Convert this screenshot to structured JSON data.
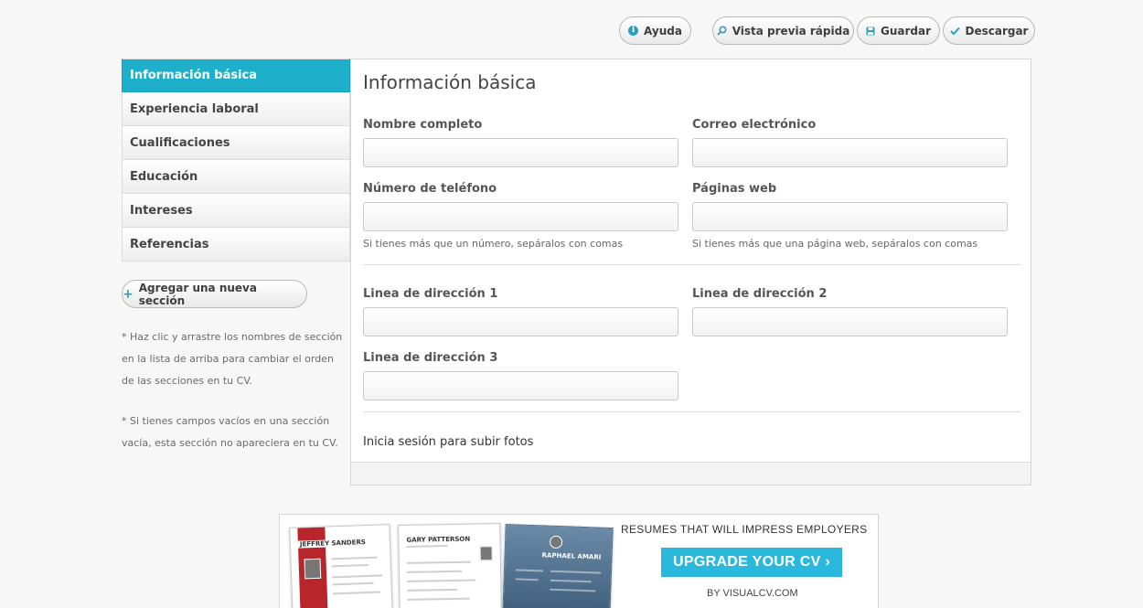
{
  "toolbar": {
    "help_label": "Ayuda",
    "help_icon": "info-icon",
    "preview_label": "Vista previa rápida",
    "preview_icon": "magnifier-icon",
    "save_label": "Guardar",
    "save_icon": "floppy-icon",
    "download_label": "Descargar",
    "download_icon": "check-icon"
  },
  "sidebar": {
    "items": [
      {
        "label": "Información básica",
        "active": true
      },
      {
        "label": "Experiencia laboral"
      },
      {
        "label": "Cualificaciones"
      },
      {
        "label": "Educación"
      },
      {
        "label": "Intereses"
      },
      {
        "label": "Referencias"
      }
    ],
    "add_section_label": "Agregar una nueva sección",
    "note1": "* Haz clic y arrastre los nombres de sección en la lista de arriba para cambiar el orden de las secciones en tu CV.",
    "note2": "* Si tienes campos vacíos en una sección vacía, esta sección no apareciera en tu CV."
  },
  "form": {
    "title": "Información básica",
    "full_name": {
      "label": "Nombre completo",
      "value": ""
    },
    "email": {
      "label": "Correo electrónico",
      "value": ""
    },
    "phone": {
      "label": "Número de teléfono",
      "value": "",
      "hint": "Si tienes más que un número, sepáralos con comas"
    },
    "websites": {
      "label": "Páginas web",
      "value": "",
      "hint": "Si tienes más que una página web, sepáralos con comas"
    },
    "address1": {
      "label": "Linea de dirección 1",
      "value": ""
    },
    "address2": {
      "label": "Linea de dirección 2",
      "value": ""
    },
    "address3": {
      "label": "Linea de dirección 3",
      "value": ""
    },
    "photo_text": "Inicia sesión para subir fotos"
  },
  "banner": {
    "headline": "RESUMES THAT WILL IMPRESS EMPLOYERS",
    "button_label": "UPGRADE YOUR CV ›",
    "by_line": "BY VISUALCV.COM",
    "cv1_name": "JEFFREY SANDERS",
    "cv2_name": "GARY PATTERSON",
    "cv3_name": "RAPHAEL AMARI",
    "accent_color": "#2ab9dc"
  }
}
